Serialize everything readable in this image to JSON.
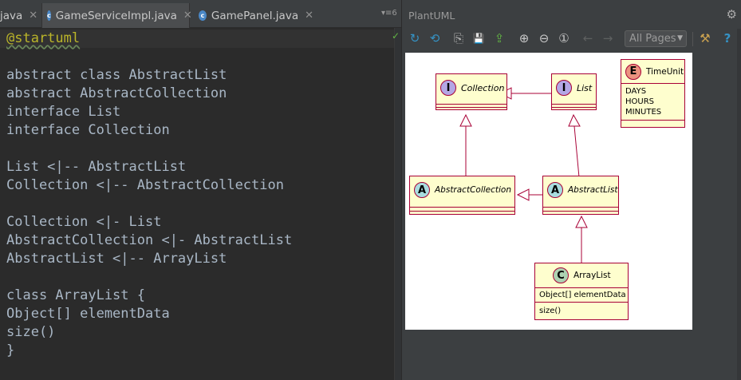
{
  "editor": {
    "tabs": [
      {
        "label": "java",
        "close": "✕"
      },
      {
        "label": "GameServiceImpl.java",
        "close": "✕"
      },
      {
        "label": "GamePanel.java",
        "close": "✕"
      }
    ],
    "tab_overflow": "▾≡6",
    "check_icon": "✓",
    "code_lines": [
      "@startuml",
      "",
      "abstract class AbstractList",
      "abstract AbstractCollection",
      "interface List",
      "interface Collection",
      "",
      "List <|-- AbstractList",
      "Collection <|-- AbstractCollection",
      "",
      "Collection <|- List",
      "AbstractCollection <|- AbstractList",
      "AbstractList <|-- ArrayList",
      "",
      "class ArrayList {",
      "Object[] elementData",
      "size()",
      "}"
    ]
  },
  "plantuml": {
    "title": "PlantUML",
    "gear": "⚙",
    "toolbar": {
      "refresh": "↻",
      "sync": "⟲",
      "copy": "⎘",
      "save": "💾",
      "export": "⇪",
      "zoom_in": "⊕",
      "zoom_out": "⊖",
      "zoom_actual": "①",
      "prev_page": "←",
      "next_page": "→",
      "pages_select": "All Pages",
      "settings": "⚒",
      "help": "?"
    },
    "diagram": {
      "classes": {
        "collection": {
          "badge": "I",
          "name": "Collection"
        },
        "list": {
          "badge": "I",
          "name": "List"
        },
        "timeunit": {
          "badge": "E",
          "name": "TimeUnit",
          "members": [
            "DAYS",
            "HOURS",
            "MINUTES"
          ]
        },
        "abstract_collection": {
          "badge": "A",
          "name": "AbstractCollection"
        },
        "abstract_list": {
          "badge": "A",
          "name": "AbstractList"
        },
        "array_list": {
          "badge": "C",
          "name": "ArrayList",
          "fields": [
            "Object[] elementData"
          ],
          "methods": [
            "size()"
          ]
        }
      }
    }
  },
  "colors": {
    "editor_bg": "#2b2b2b",
    "chrome_bg": "#3c3f41",
    "code_text": "#a9b7c6",
    "annotation": "#bbb529",
    "uml_fill": "#fefece",
    "uml_border": "#a80036",
    "accent_blue": "#3592c4"
  }
}
